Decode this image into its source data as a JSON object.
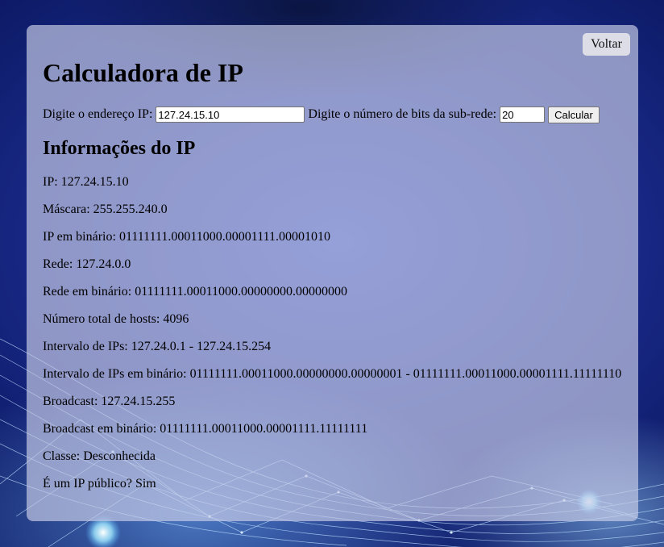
{
  "page": {
    "back_label": "Voltar",
    "title": "Calculadora de IP"
  },
  "form": {
    "ip_label": "Digite o endereço IP:",
    "ip_value": "127.24.15.10",
    "bits_label": "Digite o número de bits da sub-rede:",
    "bits_value": "20",
    "calc_label": "Calcular"
  },
  "info": {
    "heading": "Informações do IP",
    "items": [
      "IP: 127.24.15.10",
      "Máscara: 255.255.240.0",
      "IP em binário: 01111111.00011000.00001111.00001010",
      "Rede: 127.24.0.0",
      "Rede em binário: 01111111.00011000.00000000.00000000",
      "Número total de hosts: 4096",
      "Intervalo de IPs: 127.24.0.1 - 127.24.15.254",
      "Intervalo de IPs em binário: 01111111.00011000.00000000.00000001 - 01111111.00011000.00001111.11111110",
      "Broadcast: 127.24.15.255",
      "Broadcast em binário: 01111111.00011000.00001111.11111111",
      "Classe: Desconhecida",
      "É um IP público? Sim"
    ]
  },
  "colors": {
    "background": "#1b2c8e",
    "panel": "#c8cde8",
    "back_button": "#dcdde6"
  }
}
